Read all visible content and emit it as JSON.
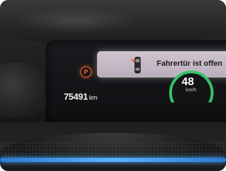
{
  "cluster": {
    "park_brake_icon": "parking-brake-icon",
    "park_brake_letter": "P",
    "park_brake_color": "#ff6a2a",
    "odometer_value": "75491",
    "odometer_unit": "km"
  },
  "notification": {
    "icon": "car-door-open-icon",
    "text": "Fahrertür ist offen"
  },
  "gauge": {
    "speed": "48",
    "unit": "km/h",
    "ring_color": "#36c468"
  },
  "ambient_light_color": "#4aa8ff"
}
